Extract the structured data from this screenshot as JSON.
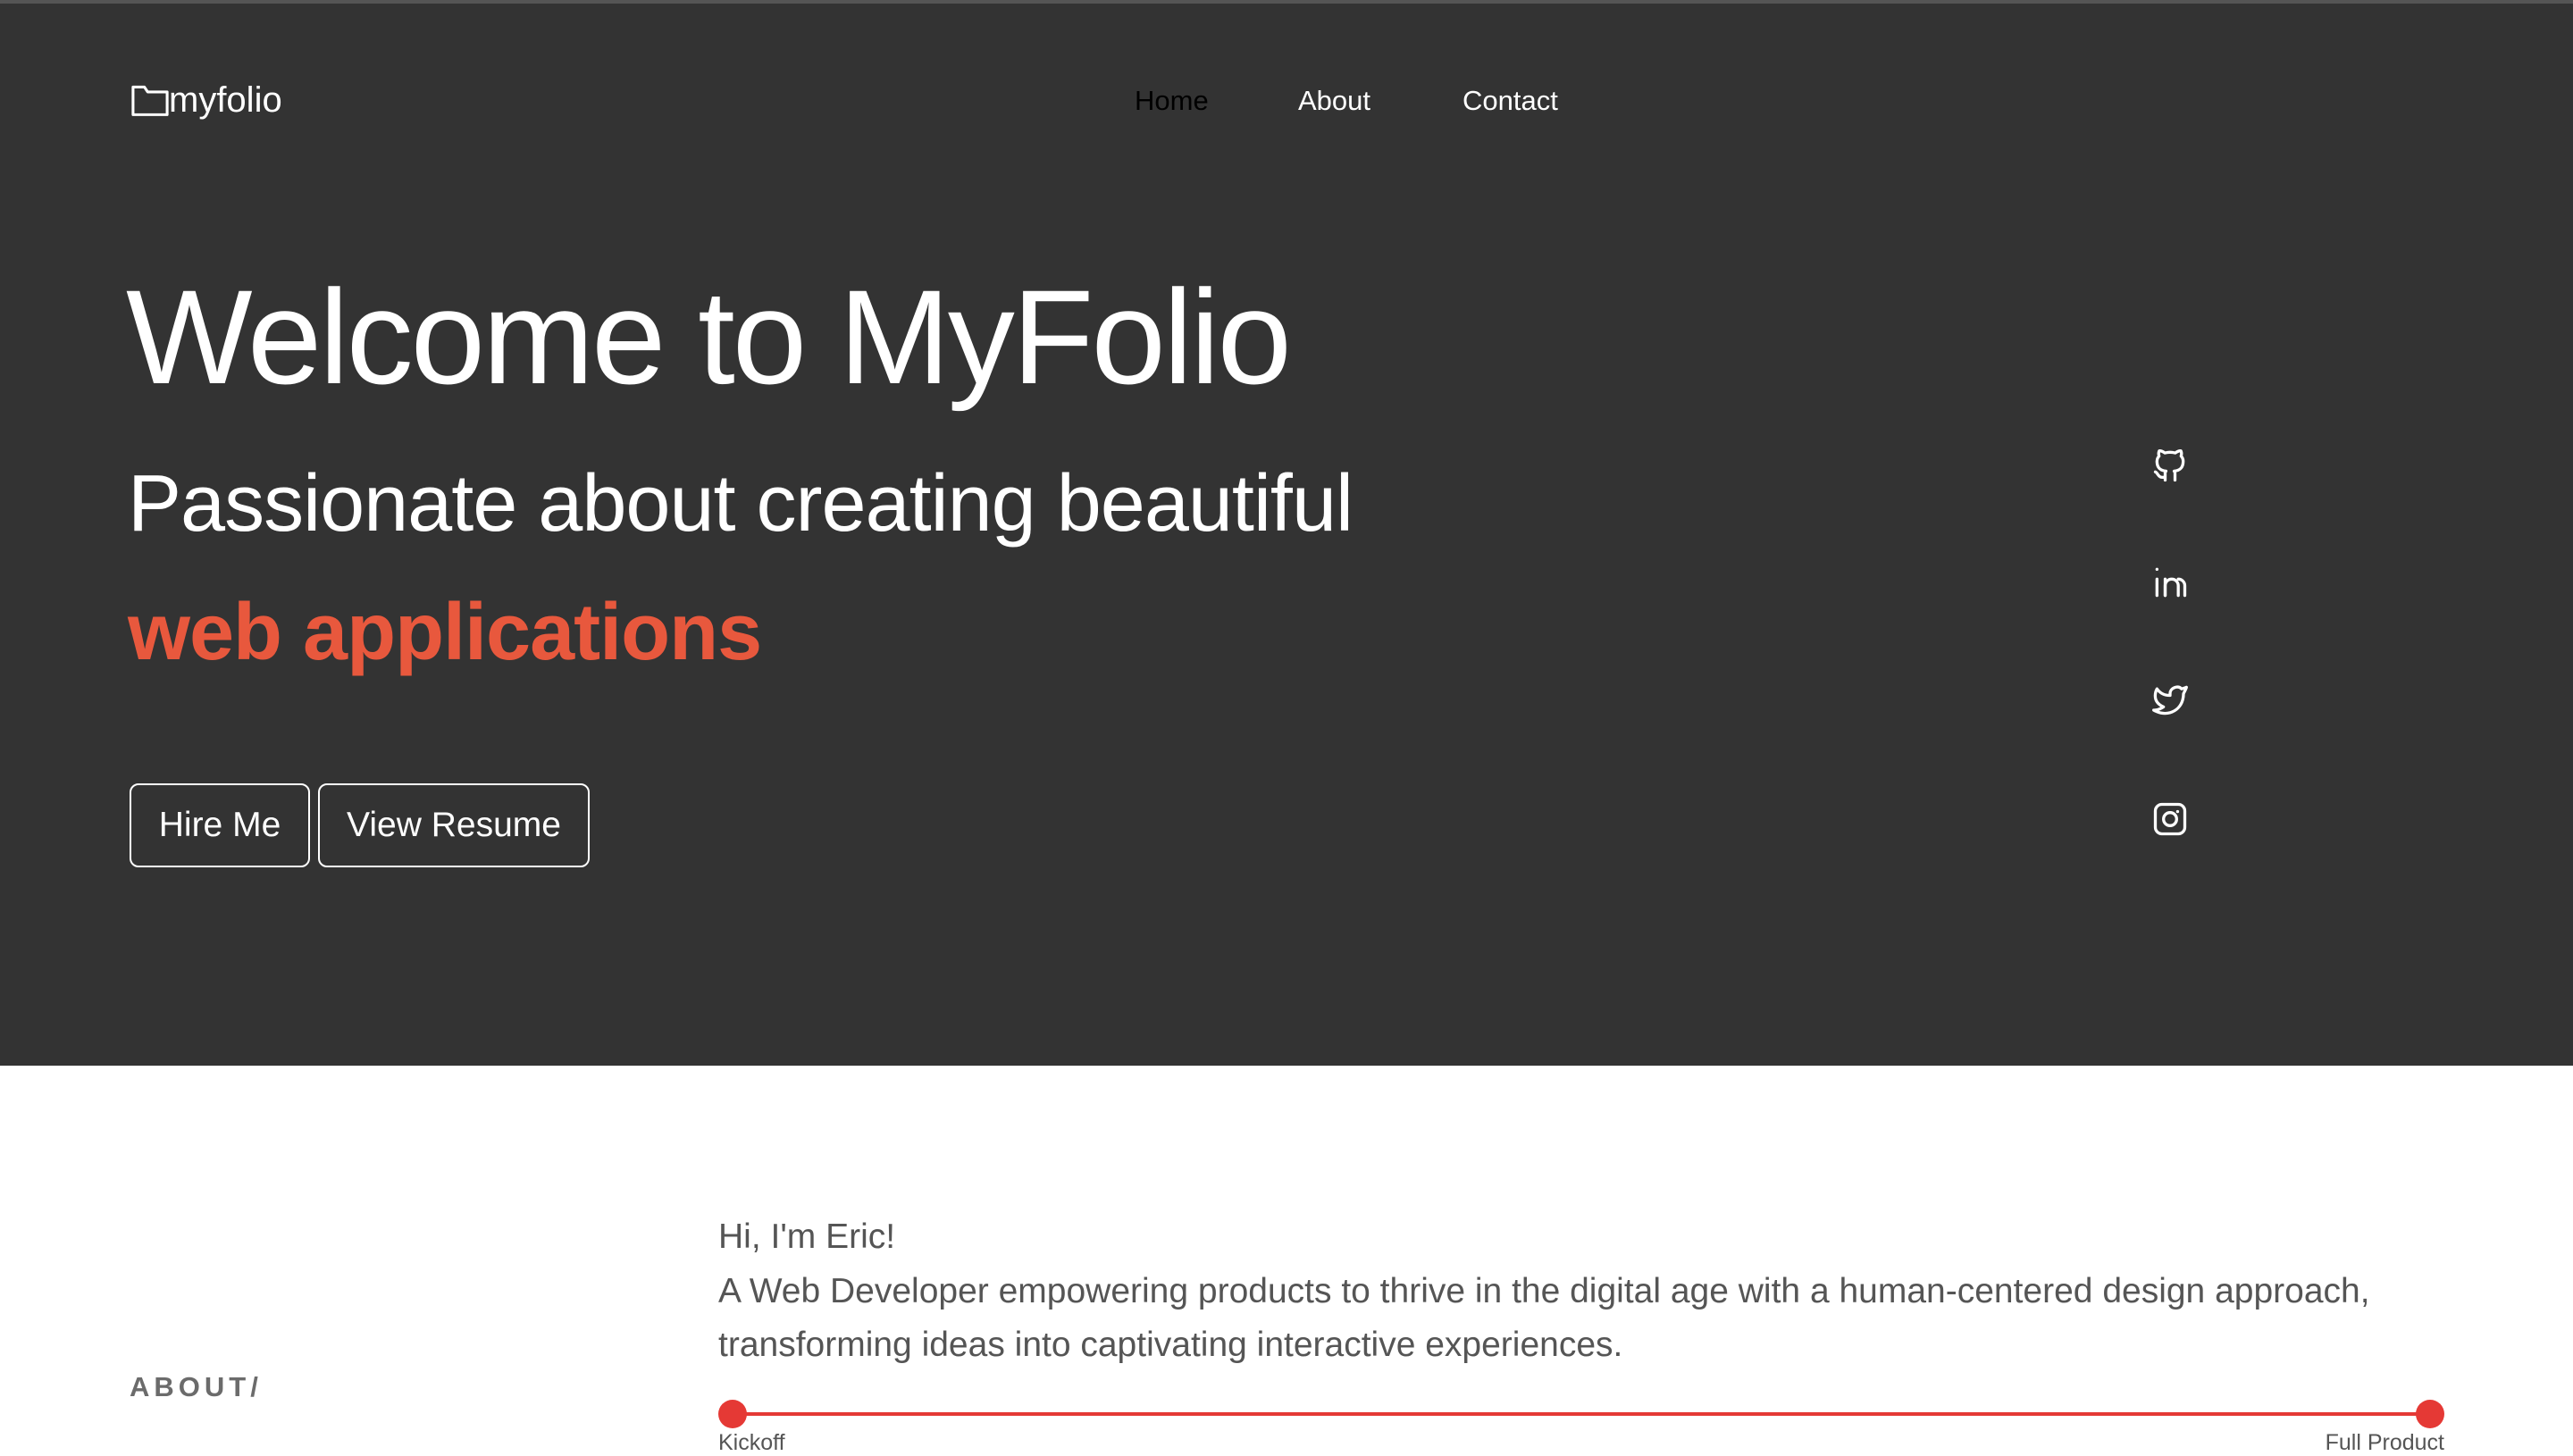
{
  "brand": {
    "name": "myfolio",
    "icon": "folder-icon"
  },
  "nav": {
    "items": [
      {
        "label": "Home",
        "active": true
      },
      {
        "label": "About",
        "active": false
      },
      {
        "label": "Contact",
        "active": false
      }
    ]
  },
  "hero": {
    "headline": "Welcome to MyFolio",
    "subline": "Passionate about creating beautiful",
    "highlight": "web applications",
    "buttons": {
      "hire": "Hire Me",
      "resume": "View Resume"
    }
  },
  "social": [
    "github-icon",
    "linkedin-icon",
    "twitter-icon",
    "instagram-icon"
  ],
  "about": {
    "label": "ABOUT/",
    "greeting": "Hi, I'm Eric!",
    "body": "A Web Developer empowering products to thrive in the digital age with a human-centered design approach, transforming ideas into captivating interactive experiences.",
    "timeline": {
      "start": "Kickoff",
      "end": "Full Product"
    }
  },
  "colors": {
    "hero_bg": "#333333",
    "accent": "#e8583d",
    "timeline": "#e53935",
    "text_muted": "#555555"
  }
}
